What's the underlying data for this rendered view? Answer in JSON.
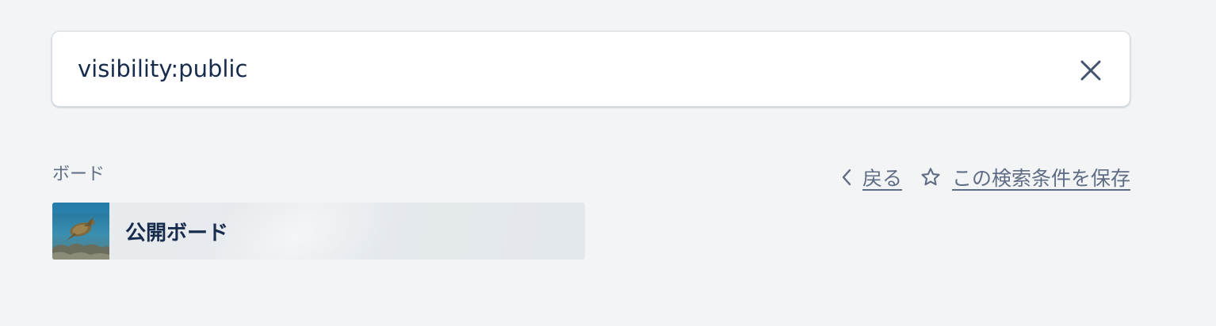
{
  "search": {
    "value": "visibility:public",
    "clear_icon": "close-icon"
  },
  "section": {
    "label": "ボード"
  },
  "actions": {
    "back_label": "戻る",
    "back_icon": "chevron-left-icon",
    "save_label": "この検索条件を保存",
    "save_icon": "star-outline-icon"
  },
  "boards": [
    {
      "name": "公開ボード",
      "thumbnail": "sea-turtle-underwater-image"
    }
  ],
  "colors": {
    "background": "#f3f4f6",
    "text_primary": "#172b4d",
    "text_secondary": "#5e6c84"
  }
}
